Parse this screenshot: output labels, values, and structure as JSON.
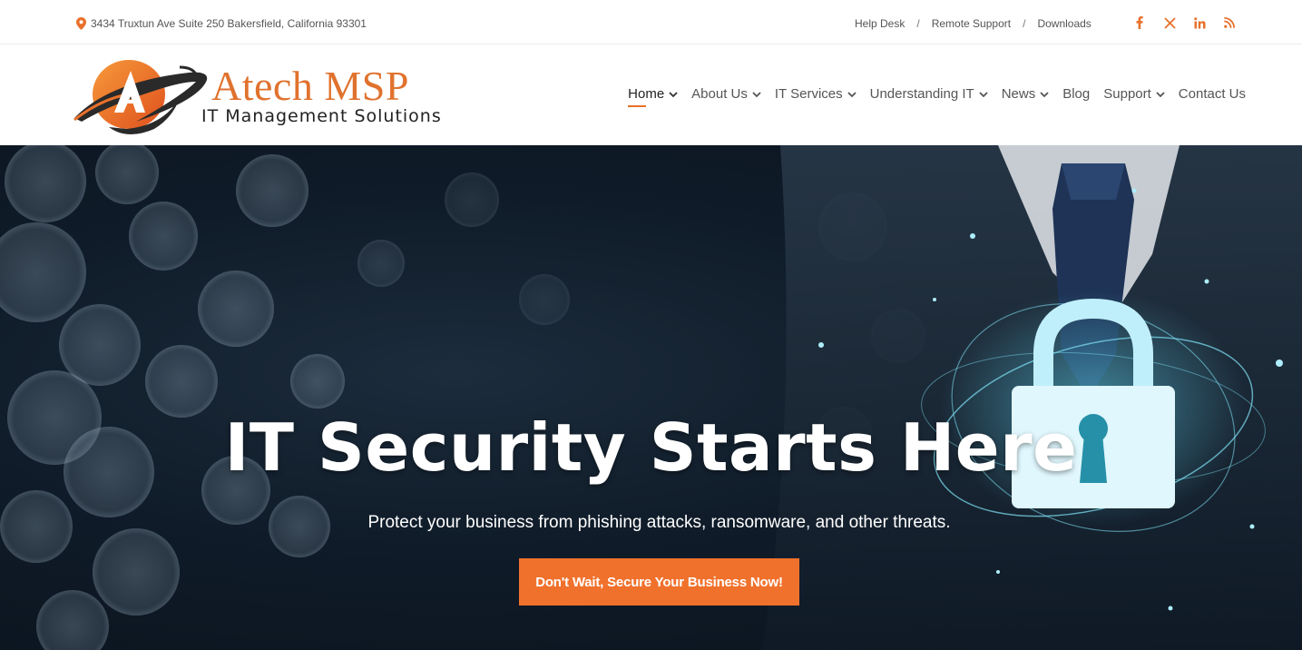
{
  "topbar": {
    "address": "3434 Truxtun Ave Suite 250 Bakersfield, California 93301",
    "links": [
      {
        "label": "Help Desk"
      },
      {
        "label": "Remote Support"
      },
      {
        "label": "Downloads"
      }
    ],
    "separator": "/",
    "social": [
      {
        "icon": "facebook-icon",
        "glyph": "f"
      },
      {
        "icon": "x-twitter-icon",
        "glyph": "𝕏"
      },
      {
        "icon": "linkedin-icon",
        "glyph": "in"
      },
      {
        "icon": "rss-icon",
        "glyph": "rss"
      }
    ]
  },
  "logo": {
    "title": "Atech MSP",
    "subtitle": "IT Management Solutions"
  },
  "nav": {
    "items": [
      {
        "label": "Home",
        "dropdown": true,
        "active": true
      },
      {
        "label": "About Us",
        "dropdown": true
      },
      {
        "label": "IT Services",
        "dropdown": true
      },
      {
        "label": "Understanding IT",
        "dropdown": true
      },
      {
        "label": "News",
        "dropdown": true
      },
      {
        "label": "Blog",
        "dropdown": false
      },
      {
        "label": "Support",
        "dropdown": true
      },
      {
        "label": "Contact Us",
        "dropdown": false
      }
    ]
  },
  "hero": {
    "title": "IT Security Starts Here",
    "subtitle": "Protect your business from phishing attacks, ransomware, and other threats.",
    "cta_label": "Don't Wait, Secure Your Business Now!"
  },
  "colors": {
    "accent": "#f0712c",
    "logo_orange": "#e0722e",
    "hero_dark": "#0f1b28",
    "lock_glow": "#5fd6f0"
  }
}
